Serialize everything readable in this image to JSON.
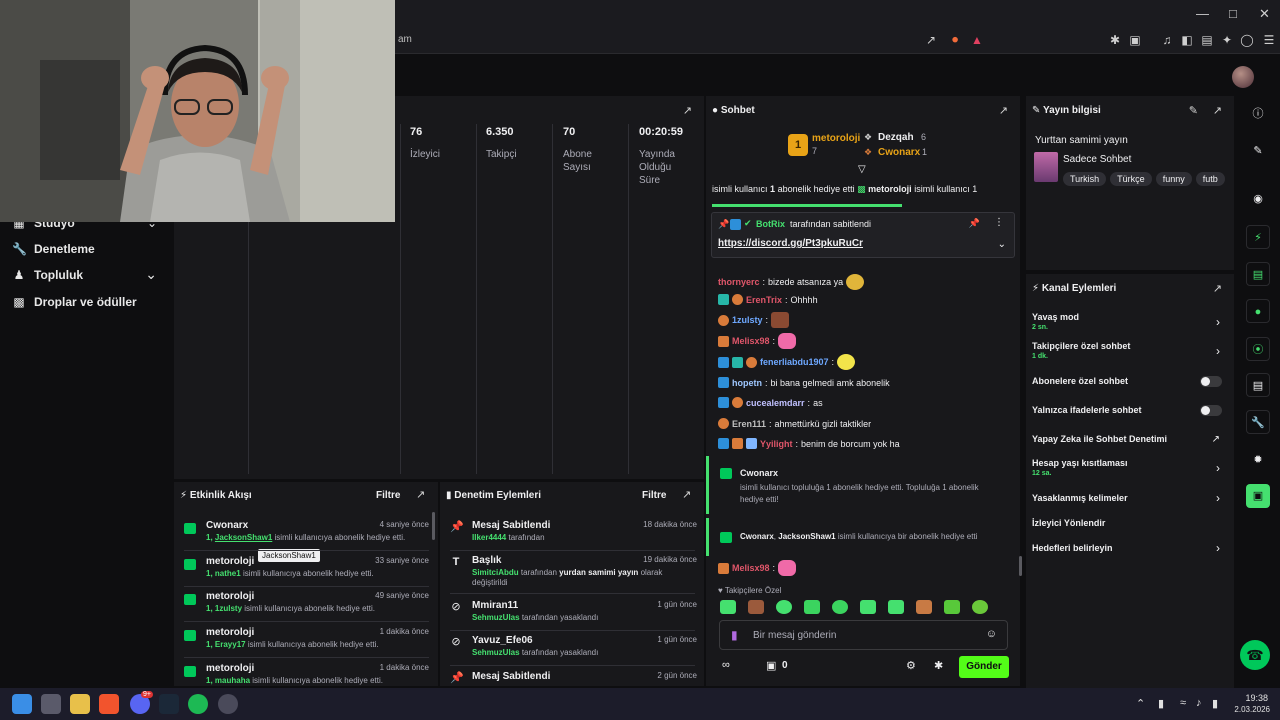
{
  "browser": {
    "address_fragment": "am",
    "window_controls": [
      "minimize-icon",
      "maximize-icon",
      "close-icon"
    ]
  },
  "leftnav": {
    "items": [
      {
        "label": "Stüdyo",
        "icon": "studio-icon",
        "has_chevron": true
      },
      {
        "label": "Denetleme",
        "icon": "wrench-icon",
        "has_chevron": false
      },
      {
        "label": "Topluluk",
        "icon": "community-icon",
        "has_chevron": true
      },
      {
        "label": "Droplar ve ödüller",
        "icon": "gift-icon",
        "has_chevron": false
      }
    ]
  },
  "stats": [
    {
      "value": "76",
      "label": "İzleyici"
    },
    {
      "value": "6.350",
      "label": "Takipçi"
    },
    {
      "value": "70",
      "label": "Abone Sayısı"
    },
    {
      "value": "00:20:59",
      "label": "Yayında Olduğu Süre"
    }
  ],
  "activity": {
    "title": "Etkinlik Akışı",
    "filter_label": "Filtre",
    "tooltip": "JacksonShaw1",
    "items": [
      {
        "name": "Cwonarx",
        "time": "4 saniye önce",
        "count": "1,",
        "user": "JacksonShaw1",
        "text": "isimli kullanıcıya abonelik hediye etti."
      },
      {
        "name": "metoroloji",
        "time": "33 saniye önce",
        "count": "1,",
        "user": "nathe1",
        "text": "isimli kullanıcıya abonelik hediye etti."
      },
      {
        "name": "metoroloji",
        "time": "49 saniye önce",
        "count": "1,",
        "user": "1zulsty",
        "text": "isimli kullanıcıya abonelik hediye etti."
      },
      {
        "name": "metoroloji",
        "time": "1 dakika önce",
        "count": "1,",
        "user": "Erayy17",
        "text": "isimli kullanıcıya abonelik hediye etti."
      },
      {
        "name": "metoroloji",
        "time": "1 dakika önce",
        "count": "1,",
        "user": "mauhaha",
        "text": "isimli kullanıcıya abonelik hediye etti."
      }
    ]
  },
  "moderation": {
    "title": "Denetim Eylemleri",
    "filter_label": "Filtre",
    "items": [
      {
        "title": "Mesaj Sabitlendi",
        "time": "18 dakika önce",
        "actor": "Ilker4444",
        "text": "tarafından",
        "icon": "pin-icon"
      },
      {
        "title": "Başlık",
        "time": "19 dakika önce",
        "actor": "SimitciAbdu",
        "text": "tarafından",
        "bold": "yurdan samimi yayın",
        "text2": "olarak değiştirildi",
        "icon": "text-icon"
      },
      {
        "title": "Mmiran11",
        "time": "1 gün önce",
        "actor": "SehmuzUlas",
        "text": "tarafından yasaklandı",
        "icon": "ban-icon"
      },
      {
        "title": "Yavuz_Efe06",
        "time": "1 gün önce",
        "actor": "SehmuzUlas",
        "text": "tarafından yasaklandı",
        "icon": "ban-icon"
      },
      {
        "title": "Mesaj Sabitlendi",
        "time": "2 gün önce",
        "icon": "pin-icon"
      }
    ]
  },
  "chat": {
    "title": "Sohbet",
    "leaderboard": {
      "rank": "1",
      "first": {
        "name": "metoroloji",
        "count": "7"
      },
      "second": {
        "name": "Dezqah",
        "count": "6"
      },
      "third": {
        "name": "Cwonarx",
        "count": "1"
      }
    },
    "gift_banner": {
      "left": "isimli kullanıcı",
      "left_count": "1",
      "left_text": "abonelik hediye etti",
      "right_name": "metoroloji",
      "right_text": "isimli kullanıcı 1"
    },
    "pinned": {
      "author": "BotRix",
      "author_suffix": "tarafından sabitlendi",
      "link": "https://discord.gg/Pt3pkuRuCr"
    },
    "messages": [
      {
        "user": "thornyerc",
        "color": "#e0566a",
        "text": "bizede atsanıza ya"
      },
      {
        "user": "ErenTrix",
        "color": "#e0566a",
        "text": "Ohhhh"
      },
      {
        "user": "1zulsty",
        "color": "#6ea8ff",
        "text": ""
      },
      {
        "user": "Melisx98",
        "color": "#e0566a",
        "text": ""
      },
      {
        "user": "fenerliabdu1907",
        "color": "#6ea8ff",
        "text": ""
      },
      {
        "user": "hopetn",
        "color": "#9fc7ff",
        "text": "bi bana gelmedi amk abonelik"
      },
      {
        "user": "cucealemdarr",
        "color": "#c0c0ff",
        "text": "as"
      },
      {
        "user": "Eren111",
        "color": "#bfbfbf",
        "text": "ahmettürkü gizli taktikler"
      },
      {
        "user": "Yyilight",
        "color": "#e0566a",
        "text": "benim de borcum yok ha"
      }
    ],
    "event1": {
      "name": "Cwonarx",
      "text": "isimli kullanıcı topluluğa 1 abonelik hediye etti. Topluluğa 1 abonelik hediye etti!"
    },
    "event2": {
      "name": "Cwonarx",
      "name2": "JacksonShaw1",
      "text": "isimli kullanıcıya bir abonelik hediye etti"
    },
    "last_user": "Melisx98",
    "followers_label": "Takipçilere Özel",
    "input_placeholder": "Bir mesaj gönderin",
    "points": "0",
    "send_label": "Gönder"
  },
  "yayin": {
    "title": "Yayın bilgisi",
    "stream_title": "Yurttan samimi yayın",
    "category": "Sadece Sohbet",
    "tags": [
      "Turkish",
      "Türkçe",
      "funny",
      "futb"
    ]
  },
  "kanal": {
    "title": "Kanal Eylemleri",
    "items": [
      {
        "label": "Yavaş mod",
        "sub": "2 sn.",
        "control": "chevron"
      },
      {
        "label": "Takipçilere özel sohbet",
        "sub": "1 dk.",
        "control": "chevron"
      },
      {
        "label": "Abonelere özel sohbet",
        "sub": "",
        "control": "toggle"
      },
      {
        "label": "Yalnızca ifadelerle sohbet",
        "sub": "",
        "control": "toggle"
      },
      {
        "label": "Yapay Zeka ile Sohbet Denetimi",
        "sub": "",
        "control": "external"
      },
      {
        "label": "Hesap yaşı kısıtlaması",
        "sub": "12 sa.",
        "control": "chevron"
      },
      {
        "label": "Yasaklanmış kelimeler",
        "sub": "",
        "control": "chevron"
      },
      {
        "label": "İzleyici Yönlendir",
        "sub": "",
        "control": "none"
      },
      {
        "label": "Hedefleri belirleyin",
        "sub": "",
        "control": "chevron"
      }
    ]
  },
  "taskbar": {
    "time": "19:38",
    "date": "2.03.2026",
    "badge_count": "9+"
  },
  "colors": {
    "accent": "#53fc18",
    "brand_green": "#00c85a",
    "panel_bg": "#18181b",
    "app_bg": "#0e0e10"
  }
}
